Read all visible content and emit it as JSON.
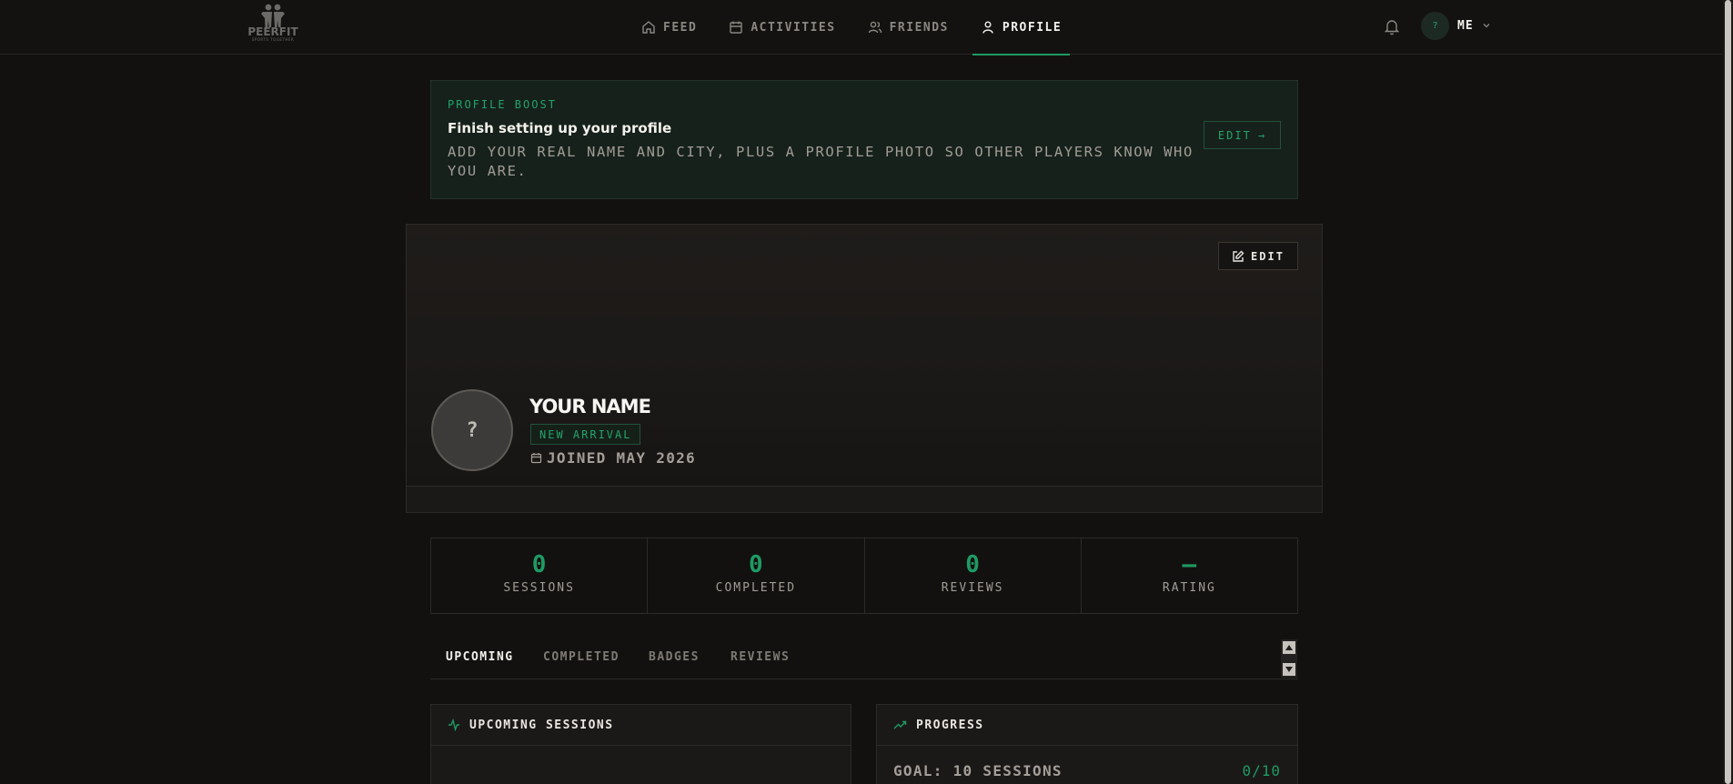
{
  "brand": {
    "name": "PEERFIT",
    "tagline": "SPORTS TOGETHER"
  },
  "nav": {
    "items": [
      {
        "label": "FEED",
        "icon": "home-icon",
        "active": false
      },
      {
        "label": "ACTIVITIES",
        "icon": "calendar-icon",
        "active": false
      },
      {
        "label": "FRIENDS",
        "icon": "users-icon",
        "active": false
      },
      {
        "label": "PROFILE",
        "icon": "user-icon",
        "active": true
      }
    ]
  },
  "user_menu": {
    "avatar_initial": "?",
    "label": "ME"
  },
  "boost": {
    "eyebrow": "PROFILE BOOST",
    "title": "Finish setting up your profile",
    "description": "Add your real name and city, plus a profile photo so other players know who you are.",
    "edit_label": "EDIT",
    "edit_arrow": "→"
  },
  "profile": {
    "edit_label": "EDIT",
    "avatar_initial": "?",
    "name": "YOUR NAME",
    "badge": "NEW ARRIVAL",
    "joined": "JOINED MAY 2026"
  },
  "stats": [
    {
      "value": "0",
      "label": "SESSIONS"
    },
    {
      "value": "0",
      "label": "COMPLETED"
    },
    {
      "value": "0",
      "label": "REVIEWS"
    },
    {
      "value": "—",
      "label": "RATING"
    }
  ],
  "tabs": [
    {
      "label": "UPCOMING",
      "active": true
    },
    {
      "label": "COMPLETED",
      "active": false
    },
    {
      "label": "BADGES",
      "active": false
    },
    {
      "label": "REVIEWS",
      "active": false
    }
  ],
  "panels": {
    "upcoming": {
      "title": "UPCOMING SESSIONS"
    },
    "progress": {
      "title": "PROGRESS",
      "goal_label": "GOAL: 10 SESSIONS",
      "goal_count": "0/10"
    }
  },
  "colors": {
    "accent": "#1f9a63",
    "background": "#121110",
    "surface": "#1b1918",
    "border": "#2d2a27"
  }
}
